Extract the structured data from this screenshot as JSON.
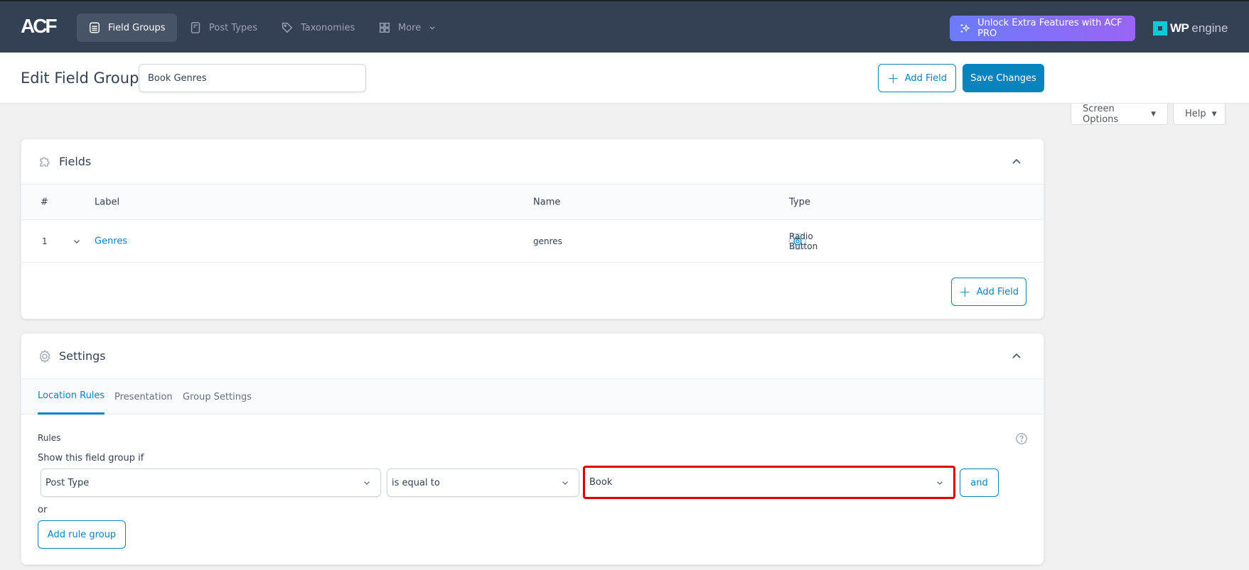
{
  "nav": {
    "logo": "ACF",
    "items": [
      {
        "label": "Field Groups",
        "icon": "list-icon",
        "active": true
      },
      {
        "label": "Post Types",
        "icon": "document-icon",
        "active": false
      },
      {
        "label": "Taxonomies",
        "icon": "tag-icon",
        "active": false
      },
      {
        "label": "More",
        "icon": "grid-icon",
        "active": false
      }
    ],
    "pro_button": "Unlock Extra Features with ACF PRO",
    "brand": {
      "bold": "WP",
      "light": "engine"
    }
  },
  "header": {
    "title": "Edit Field Group",
    "group_title_value": "Book Genres",
    "add_field_label": "Add Field",
    "save_label": "Save Changes"
  },
  "screen_meta": {
    "screen_options": "Screen Options",
    "help": "Help"
  },
  "fields_panel": {
    "title": "Fields",
    "columns": [
      "#",
      "Label",
      "Name",
      "Type"
    ],
    "rows": [
      {
        "order": "1",
        "label": "Genres",
        "name": "genres",
        "type": "Radio Button"
      }
    ],
    "add_field_label": "Add Field"
  },
  "settings_panel": {
    "title": "Settings",
    "tabs": [
      {
        "label": "Location Rules",
        "active": true
      },
      {
        "label": "Presentation",
        "active": false
      },
      {
        "label": "Group Settings",
        "active": false
      }
    ],
    "rules_label": "Rules",
    "show_if_label": "Show this field group if",
    "rule": {
      "param": "Post Type",
      "operator": "is equal to",
      "value": "Book"
    },
    "and_label": "and",
    "or_label": "or",
    "add_rule_group_label": "Add rule group"
  },
  "colors": {
    "nav_bg": "#344155",
    "accent": "#0783be",
    "highlight": "#e00000"
  }
}
